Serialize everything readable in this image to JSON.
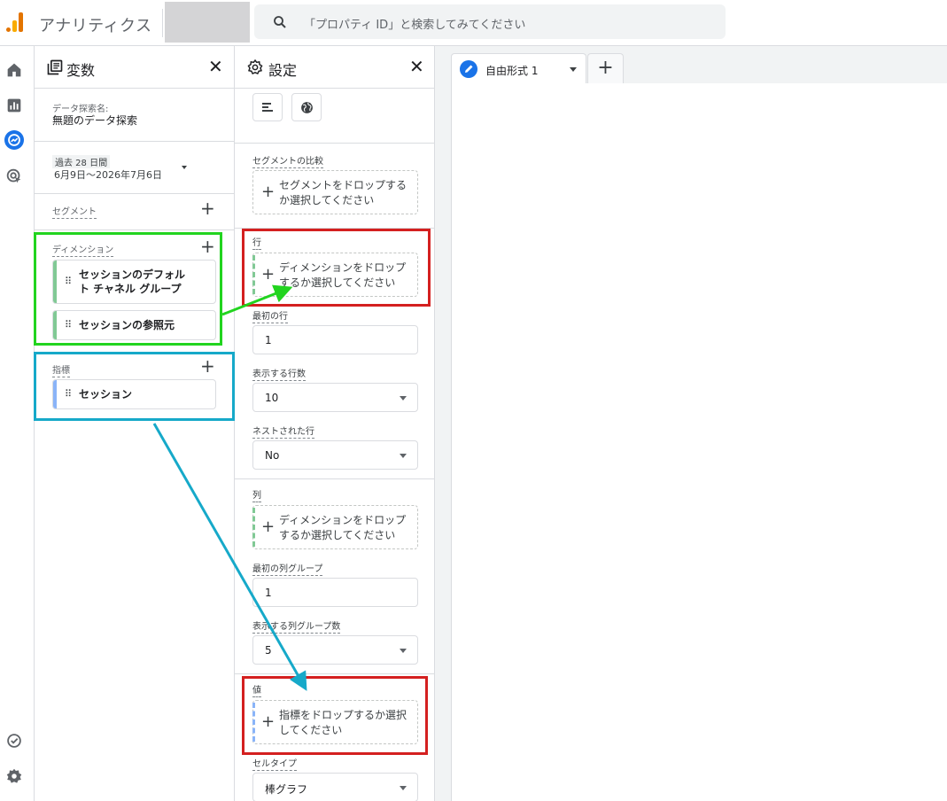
{
  "header": {
    "app_title": "アナリティクス",
    "search_placeholder": "「プロパティ ID」と検索してみてください"
  },
  "variables": {
    "title": "変数",
    "exploration_name_label": "データ探索名:",
    "exploration_name": "無題のデータ探索",
    "date_badge": "過去 28 日間",
    "date_range": "6月9日～2026年7月6日",
    "segments_label": "セグメント",
    "dimensions_label": "ディメンション",
    "dimensions": [
      {
        "line1": "セッションのデフォル",
        "line2": "ト チャネル グループ"
      },
      {
        "line1": "セッションの参照元",
        "line2": ""
      }
    ],
    "metrics_label": "指標",
    "metrics": [
      {
        "label": "セッション"
      }
    ]
  },
  "settings": {
    "title": "設定",
    "segment_compare_label": "セグメントの比較",
    "segment_drop_line1": "セグメントをドロップする",
    "segment_drop_line2": "か選択してください",
    "rows_label": "行",
    "rows_drop_line1": "ディメンションをドロップ",
    "rows_drop_line2": "するか選択してください",
    "first_row_label": "最初の行",
    "first_row_value": "1",
    "rows_shown_label": "表示する行数",
    "rows_shown_value": "10",
    "nested_rows_label": "ネストされた行",
    "nested_rows_value": "No",
    "columns_label": "列",
    "columns_drop_line1": "ディメンションをドロップ",
    "columns_drop_line2": "するか選択してください",
    "first_col_group_label": "最初の列グループ",
    "first_col_group_value": "1",
    "col_groups_shown_label": "表示する列グループ数",
    "col_groups_shown_value": "5",
    "values_label": "値",
    "values_drop_line1": "指標をドロップするか選択",
    "values_drop_line2": "してください",
    "cell_type_label": "セルタイプ",
    "cell_type_value": "棒グラフ"
  },
  "canvas": {
    "tab_label": "自由形式 1"
  },
  "colors": {
    "accent": "#1a73e8",
    "dimension_bar": "#81c995",
    "metric_bar": "#8ab4f8",
    "annotation_green": "#22d41f",
    "annotation_blue": "#16a9c9",
    "annotation_red": "#d42020"
  },
  "icons": [
    "analytics-logo-icon",
    "search-icon",
    "home-icon",
    "reports-icon",
    "explore-icon",
    "advertising-icon",
    "admin-check-icon",
    "settings-gear-icon",
    "variables-icon",
    "settings-icon",
    "close-icon",
    "plus-icon",
    "drag-handle-icon",
    "pencil-icon",
    "chevron-down-icon"
  ]
}
